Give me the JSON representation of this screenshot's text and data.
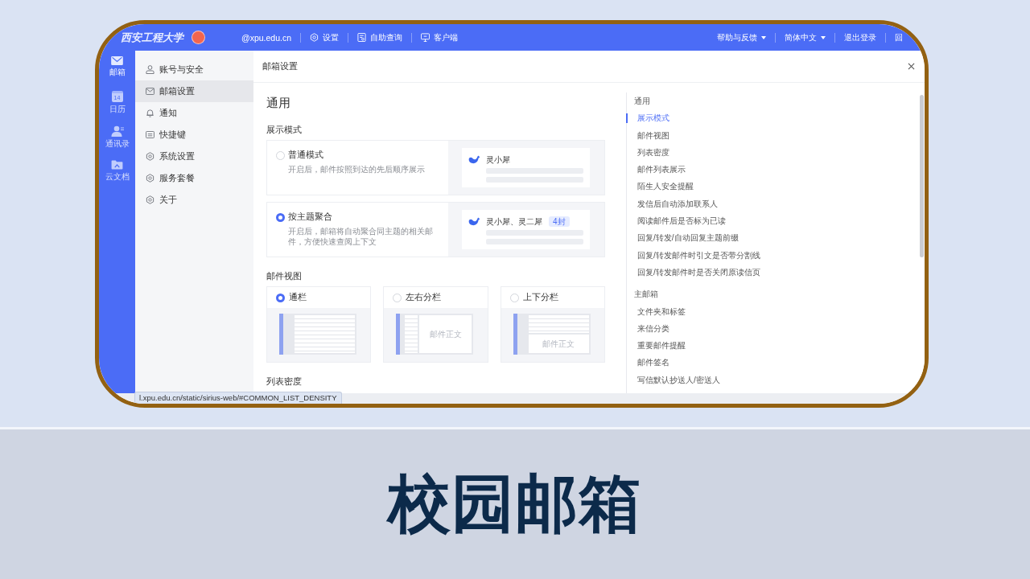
{
  "top_bar": {
    "logo_text": "西安工程大学",
    "account": "@xpu.edu.cn",
    "links": [
      {
        "label": "设置"
      },
      {
        "label": "自助查询"
      },
      {
        "label": "客户端"
      }
    ],
    "menus": [
      {
        "label": "帮助与反馈",
        "dropdown": true
      },
      {
        "label": "简体中文",
        "dropdown": true
      },
      {
        "label": "退出登录",
        "dropdown": false
      },
      {
        "label": "回",
        "dropdown": false
      }
    ]
  },
  "app_nav": [
    {
      "label": "邮箱",
      "selected": true
    },
    {
      "label": "日历",
      "day": "14",
      "selected": false
    },
    {
      "label": "通讯录",
      "selected": false
    },
    {
      "label": "云文档",
      "selected": false
    }
  ],
  "sidebar": {
    "items": [
      {
        "label": "账号与安全",
        "selected": false
      },
      {
        "label": "邮箱设置",
        "selected": true
      },
      {
        "label": "通知",
        "selected": false
      },
      {
        "label": "快捷键",
        "selected": false
      },
      {
        "label": "系统设置",
        "selected": false
      },
      {
        "label": "服务套餐",
        "selected": false
      },
      {
        "label": "关于",
        "selected": false
      }
    ]
  },
  "panel": {
    "title": "邮箱设置",
    "heading": "通用",
    "display_mode": {
      "title": "展示模式",
      "options": [
        {
          "label": "普通模式",
          "description": "开启后，邮件按照到达的先后顺序展示",
          "selected": false,
          "preview": {
            "sender": "灵小犀"
          }
        },
        {
          "label": "按主题聚合",
          "description": "开启后，邮箱将自动聚合同主题的相关邮件，方便快速查阅上下文",
          "selected": true,
          "preview": {
            "sender": "灵小犀、灵二犀",
            "count": "4封"
          }
        }
      ]
    },
    "mail_view": {
      "title": "邮件视图",
      "options": [
        {
          "label": "通栏",
          "kind": "single",
          "selected": true
        },
        {
          "label": "左右分栏",
          "kind": "columns",
          "selected": false,
          "body_text": "邮件正文"
        },
        {
          "label": "上下分栏",
          "kind": "rows",
          "selected": false,
          "body_text": "邮件正文"
        }
      ]
    },
    "list_density": {
      "title": "列表密度"
    }
  },
  "outline": {
    "groups": [
      {
        "label": "通用",
        "items": [
          {
            "label": "展示模式",
            "selected": true
          },
          {
            "label": "邮件视图",
            "selected": false
          },
          {
            "label": "列表密度",
            "selected": false
          },
          {
            "label": "邮件列表展示",
            "selected": false
          },
          {
            "label": "陌生人安全提醒",
            "selected": false
          },
          {
            "label": "发信后自动添加联系人",
            "selected": false
          },
          {
            "label": "阅读邮件后是否标为已读",
            "selected": false
          },
          {
            "label": "回复/转发/自动回复主题前缀",
            "selected": false
          },
          {
            "label": "回复/转发邮件时引文是否带分割线",
            "selected": false
          },
          {
            "label": "回复/转发邮件时是否关闭原读信页",
            "selected": false
          }
        ]
      },
      {
        "label": "主邮箱",
        "items": [
          {
            "label": "文件夹和标签",
            "selected": false
          },
          {
            "label": "来信分类",
            "selected": false
          },
          {
            "label": "重要邮件提醒",
            "selected": false
          },
          {
            "label": "邮件签名",
            "selected": false
          },
          {
            "label": "写信默认抄送人/密送人",
            "selected": false
          }
        ]
      }
    ]
  },
  "status_url": "l.xpu.edu.cn/static/sirius-web/#COMMON_LIST_DENSITY",
  "slide_title": "校园邮箱"
}
